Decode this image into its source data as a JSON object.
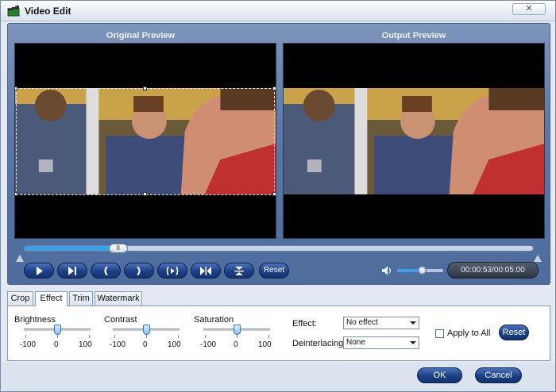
{
  "window": {
    "title": "Video Edit",
    "close_label": "✕"
  },
  "preview": {
    "original_label": "Original Preview",
    "output_label": "Output Preview"
  },
  "playback": {
    "progress_fraction": 0.17,
    "thumb_glyph": "II",
    "reset_label": "Reset",
    "volume_fraction": 0.55,
    "time": "00:00:53/00:05:00"
  },
  "tabs": [
    {
      "label": "Crop",
      "active": false
    },
    {
      "label": "Effect",
      "active": true
    },
    {
      "label": "Trim",
      "active": false
    },
    {
      "label": "Watermark",
      "active": false
    }
  ],
  "effect_panel": {
    "brightness": {
      "label": "Brightness",
      "min": "-100",
      "mid": "0",
      "max": "100",
      "value": 0
    },
    "contrast": {
      "label": "Contrast",
      "min": "-100",
      "mid": "0",
      "max": "100",
      "value": 0
    },
    "saturation": {
      "label": "Saturation",
      "min": "-100",
      "mid": "0",
      "max": "100",
      "value": 0
    },
    "effect_label": "Effect:",
    "effect_value": "No effect",
    "deinterlacing_label": "Deinterlacing:",
    "deinterlacing_value": "None",
    "apply_all_label": "Apply to All",
    "apply_all_checked": false,
    "reset_label": "Reset"
  },
  "footer": {
    "ok_label": "OK",
    "cancel_label": "Cancel"
  },
  "colors": {
    "accent": "#1c3f86",
    "panel": "#5b79a8",
    "progress": "#3fa0e8"
  }
}
